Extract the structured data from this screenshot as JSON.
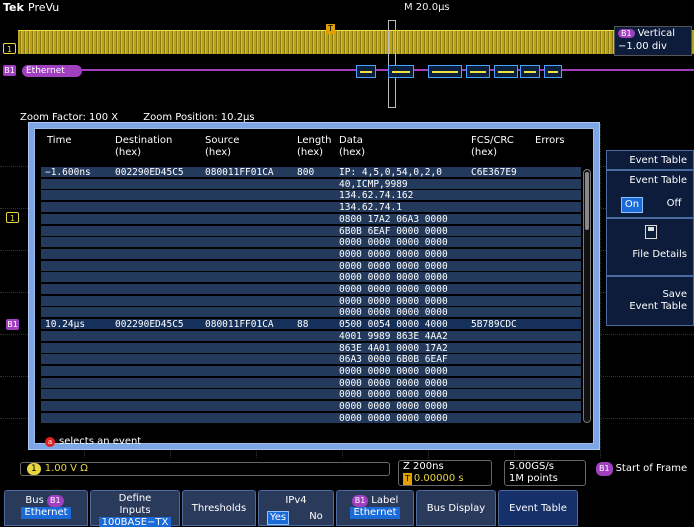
{
  "top": {
    "brand": "Tek",
    "mode": "PreVu",
    "horizontal_scale": "M 20.0µs"
  },
  "overview": {
    "ch1_marker": "1",
    "b1_marker": "B1",
    "bus_label": "Ethernet",
    "vertical_title": "Vertical",
    "vertical_value": "−1.00 div",
    "b1_badge": "B1",
    "trigger_marker": "T"
  },
  "zoom_info": {
    "factor": "Zoom Factor: 100 X",
    "position": "Zoom Position: 10.2µs"
  },
  "event_table": {
    "columns": [
      "Time",
      "Destination (hex)",
      "Source (hex)",
      "Length (hex)",
      "Data (hex)",
      "FCS/CRC (hex)",
      "Errors"
    ],
    "col_time": "Time",
    "col_dest_1": "Destination",
    "col_dest_2": "(hex)",
    "col_src_1": "Source",
    "col_src_2": "(hex)",
    "col_len_1": "Length",
    "col_len_2": "(hex)",
    "col_data_1": "Data",
    "col_data_2": "(hex)",
    "col_fcs_1": "FCS/CRC",
    "col_fcs_2": "(hex)",
    "col_err": "Errors",
    "rows": [
      {
        "time": "−1.600ns",
        "dest": "002290ED45C5",
        "src": "080011FF01CA",
        "len": "800",
        "data": "IP: 4,5,0,54,0,2,0",
        "fcs": "C6E367E9",
        "sel": false
      },
      {
        "time": "",
        "dest": "",
        "src": "",
        "len": "",
        "data": "40,ICMP,9989",
        "fcs": "",
        "sel": false
      },
      {
        "time": "",
        "dest": "",
        "src": "",
        "len": "",
        "data": "134.62.74.162",
        "fcs": "",
        "sel": false
      },
      {
        "time": "",
        "dest": "",
        "src": "",
        "len": "",
        "data": "134.62.74.1",
        "fcs": "",
        "sel": false
      },
      {
        "time": "",
        "dest": "",
        "src": "",
        "len": "",
        "data": "0800 17A2 06A3 0000",
        "fcs": "",
        "sel": false
      },
      {
        "time": "",
        "dest": "",
        "src": "",
        "len": "",
        "data": "6B0B 6EAF 0000 0000",
        "fcs": "",
        "sel": false
      },
      {
        "time": "",
        "dest": "",
        "src": "",
        "len": "",
        "data": "0000 0000 0000 0000",
        "fcs": "",
        "sel": false
      },
      {
        "time": "",
        "dest": "",
        "src": "",
        "len": "",
        "data": "0000 0000 0000 0000",
        "fcs": "",
        "sel": false
      },
      {
        "time": "",
        "dest": "",
        "src": "",
        "len": "",
        "data": "0000 0000 0000 0000",
        "fcs": "",
        "sel": false
      },
      {
        "time": "",
        "dest": "",
        "src": "",
        "len": "",
        "data": "0000 0000 0000 0000",
        "fcs": "",
        "sel": false
      },
      {
        "time": "",
        "dest": "",
        "src": "",
        "len": "",
        "data": "0000 0000 0000 0000",
        "fcs": "",
        "sel": false
      },
      {
        "time": "",
        "dest": "",
        "src": "",
        "len": "",
        "data": "0000 0000 0000 0000",
        "fcs": "",
        "sel": false
      },
      {
        "time": "",
        "dest": "",
        "src": "",
        "len": "",
        "data": "0000 0000 0000 0000",
        "fcs": "",
        "sel": false
      },
      {
        "time": "10.24µs",
        "dest": "002290ED45C5",
        "src": "080011FF01CA",
        "len": "88",
        "data": "0500 0054 0000 4000",
        "fcs": "5B789CDC",
        "sel": true
      },
      {
        "time": "",
        "dest": "",
        "src": "",
        "len": "",
        "data": "4001 9989 863E 4AA2",
        "fcs": "",
        "sel": false
      },
      {
        "time": "",
        "dest": "",
        "src": "",
        "len": "",
        "data": "863E 4A01 0000 17A2",
        "fcs": "",
        "sel": false
      },
      {
        "time": "",
        "dest": "",
        "src": "",
        "len": "",
        "data": "06A3 0000 6B0B 6EAF",
        "fcs": "",
        "sel": false
      },
      {
        "time": "",
        "dest": "",
        "src": "",
        "len": "",
        "data": "0000 0000 0000 0000",
        "fcs": "",
        "sel": false
      },
      {
        "time": "",
        "dest": "",
        "src": "",
        "len": "",
        "data": "0000 0000 0000 0000",
        "fcs": "",
        "sel": false
      },
      {
        "time": "",
        "dest": "",
        "src": "",
        "len": "",
        "data": "0000 0000 0000 0000",
        "fcs": "",
        "sel": false
      },
      {
        "time": "",
        "dest": "",
        "src": "",
        "len": "",
        "data": "0000 0000 0000 0000",
        "fcs": "",
        "sel": false
      },
      {
        "time": "",
        "dest": "",
        "src": "",
        "len": "",
        "data": "0000 0000 0000 0000",
        "fcs": "",
        "sel": false
      }
    ],
    "hint_button": "a",
    "hint": "selects an event"
  },
  "side_menu": {
    "title": "Event Table",
    "toggle_label": "Event Table",
    "on": "On",
    "off": "Off",
    "file_details": "File Details",
    "save_line1": "Save",
    "save_line2": "Event Table"
  },
  "readouts": {
    "ch1_num": "1",
    "ch1_value": "1.00 V Ω",
    "zoom_line1": "Z 200ns",
    "zoom_line2": "0.00000 s",
    "rate_line1": "5.00GS/s",
    "rate_line2": "1M points",
    "trig_badge": "B1",
    "trig_text": "Start of Frame"
  },
  "bottom_menu": {
    "bus_line1": "Bus",
    "bus_badge": "B1",
    "bus_line2": "Ethernet",
    "define_line1": "Define",
    "define_line2": "Inputs",
    "define_line3": "100BASE−TX",
    "thresholds": "Thresholds",
    "ipv4": "IPv4",
    "ipv4_yes": "Yes",
    "ipv4_no": "No",
    "label_badge": "B1",
    "label_line1": "Label",
    "label_line2": "Ethernet",
    "bus_display": "Bus Display",
    "event_table": "Event Table"
  },
  "colors": {
    "ch1": "#e8d640",
    "bus": "#a040c0",
    "menu_bg": "#2a3a5a",
    "selected": "#1a6ad8"
  }
}
